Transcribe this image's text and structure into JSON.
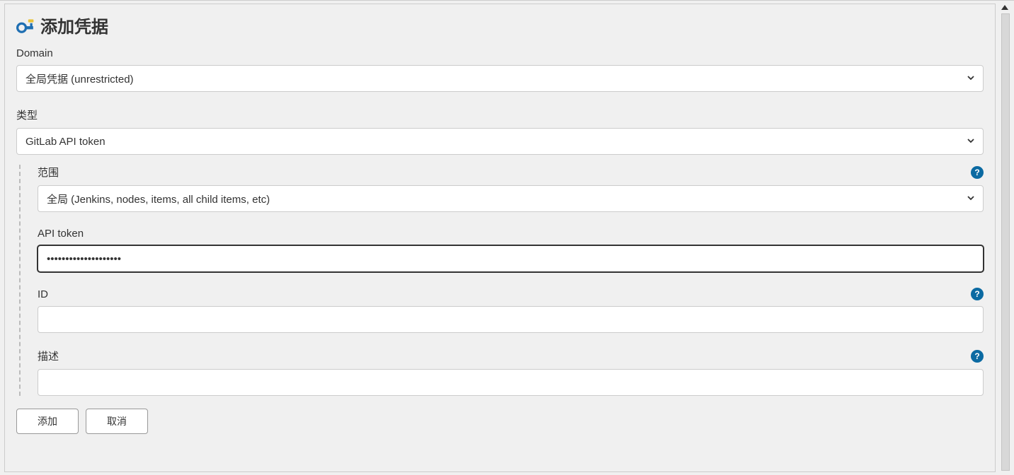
{
  "header": {
    "title": "添加凭据"
  },
  "fields": {
    "domain": {
      "label": "Domain",
      "value": "全局凭据 (unrestricted)"
    },
    "kind": {
      "label": "类型",
      "value": "GitLab API token"
    },
    "scope": {
      "label": "范围",
      "value": "全局 (Jenkins, nodes, items, all child items, etc)"
    },
    "api_token": {
      "label": "API token",
      "value": "••••••••••••••••••••"
    },
    "id": {
      "label": "ID",
      "value": ""
    },
    "description": {
      "label": "描述",
      "value": ""
    }
  },
  "buttons": {
    "add": "添加",
    "cancel": "取消"
  },
  "icons": {
    "key": "key-icon",
    "help": "?",
    "chevron": "chevron-down-icon"
  }
}
